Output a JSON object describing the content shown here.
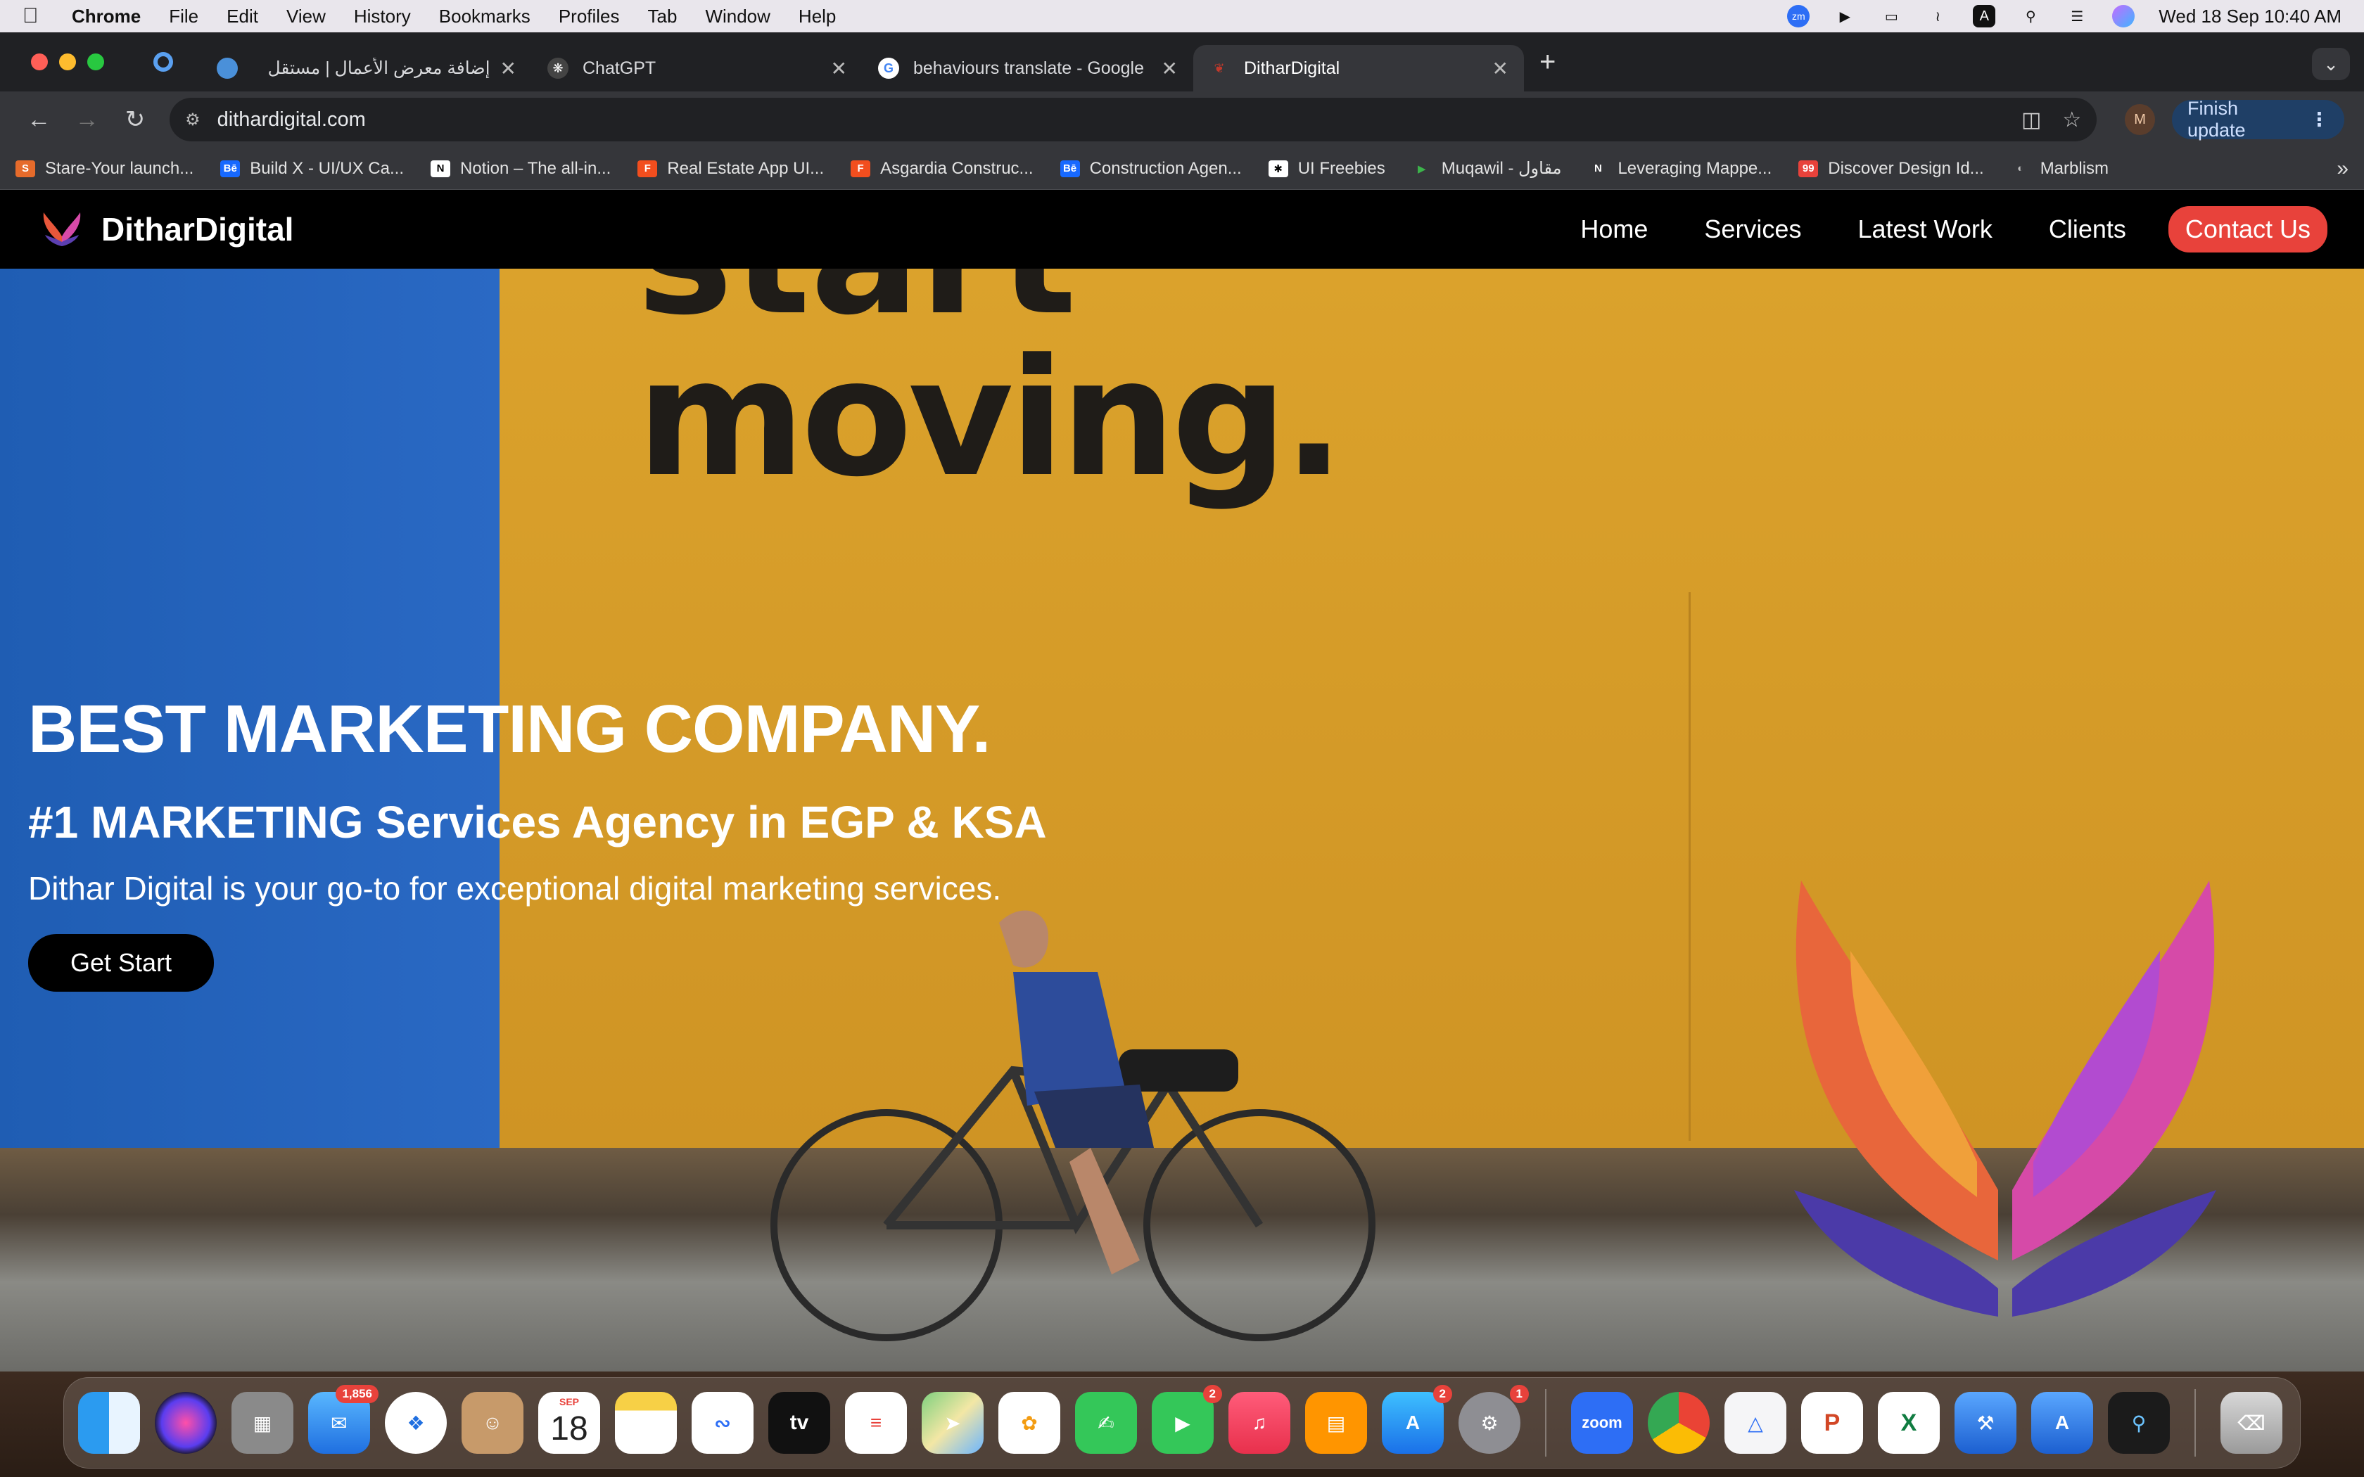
{
  "menubar": {
    "app": "Chrome",
    "items": [
      "File",
      "Edit",
      "View",
      "History",
      "Bookmarks",
      "Profiles",
      "Tab",
      "Window",
      "Help"
    ],
    "datetime": "Wed 18 Sep  10:40 AM",
    "zoom_label": "zm",
    "input_label": "A"
  },
  "tabs": [
    {
      "title": "إضافة معرض الأعمال | مستقل",
      "color": "#4a90d9"
    },
    {
      "title": "ChatGPT",
      "color": "#444"
    },
    {
      "title": "behaviours translate - Google",
      "color": "#4285f4"
    },
    {
      "title": "DitharDigital",
      "color": "#c0392b"
    }
  ],
  "toolbar": {
    "url": "dithardigital.com",
    "profile_initial": "M",
    "finish_update": "Finish update"
  },
  "bookmarks": [
    {
      "label": "Stare-Your launch...",
      "color": "#e66b2b",
      "glyph": "S"
    },
    {
      "label": "Build X - UI/UX Ca...",
      "color": "#1769ff",
      "glyph": "Bē"
    },
    {
      "label": "Notion – The all-in...",
      "color": "#ffffff",
      "glyph": "N"
    },
    {
      "label": "Real Estate App UI...",
      "color": "#f24e1e",
      "glyph": "F"
    },
    {
      "label": "Asgardia Construc...",
      "color": "#f24e1e",
      "glyph": "F"
    },
    {
      "label": "Construction Agen...",
      "color": "#1769ff",
      "glyph": "Bē"
    },
    {
      "label": "UI Freebies",
      "color": "#ffffff",
      "glyph": "✱"
    },
    {
      "label": "Muqawil - مقاول",
      "color": "#2e7d32",
      "glyph": "▶"
    },
    {
      "label": "Leveraging Mappe...",
      "color": "#333333",
      "glyph": "N"
    },
    {
      "label": "Discover Design Id...",
      "color": "#e8423b",
      "glyph": "99"
    },
    {
      "label": "Marblism",
      "color": "#777777",
      "glyph": "◐"
    }
  ],
  "site": {
    "brand": "DitharDigital",
    "nav": [
      "Home",
      "Services",
      "Latest Work",
      "Clients"
    ],
    "cta": "Contact Us",
    "poster_top": "start",
    "poster_text": "moving.",
    "hero_title": "BEST MARKETING COMPANY.",
    "hero_subtitle": "#1 MARKETING Services Agency in EGP & KSA",
    "hero_text": "Dithar Digital is your go-to for exceptional digital marketing services.",
    "hero_button": "Get Start"
  },
  "dock": {
    "mail_badge": "1,856",
    "facetime_badge": "2",
    "appstore_badge": "2",
    "settings_badge": "1",
    "calendar_month": "SEP",
    "calendar_day": "18",
    "tv_label": "tv",
    "zoom_label": "zoom",
    "powerpoint_label": "P",
    "excel_label": "X"
  }
}
